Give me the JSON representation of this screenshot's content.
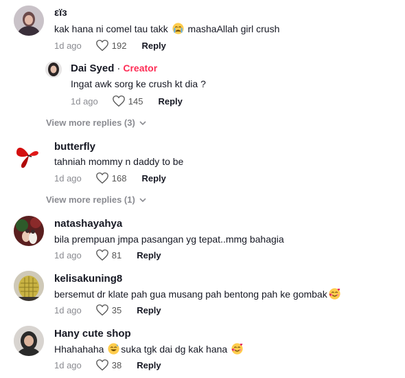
{
  "comments": [
    {
      "username": "εïз",
      "text_before": "kak hana ni comel tau takk ",
      "emoji": "crying-face-emoji",
      "text_after": " mashaAllah girl crush",
      "time": "1d ago",
      "likes": "192",
      "reply_label": "Reply"
    },
    {
      "username": "butterfly",
      "text": "tahniah mommy n daddy to be",
      "time": "1d ago",
      "likes": "168",
      "reply_label": "Reply"
    },
    {
      "username": "natashayahya",
      "text": "bila prempuan jmpa pasangan yg tepat..mmg bahagia",
      "time": "1d ago",
      "likes": "81",
      "reply_label": "Reply"
    },
    {
      "username": "kelisakuning8",
      "text": "bersemut dr klate pah gua musang pah bentong pah ke gombak",
      "emoji": "smiling-face-with-hearts-emoji",
      "time": "1d ago",
      "likes": "35",
      "reply_label": "Reply"
    },
    {
      "username": "Hany cute shop",
      "text_before": "Hhahahaha ",
      "emoji": "grinning-sweat-emoji",
      "text_after": "suka tgk dai dg kak hana ",
      "emoji2": "smiling-face-with-hearts-emoji",
      "time": "1d ago",
      "likes": "38",
      "reply_label": "Reply"
    }
  ],
  "creator_reply": {
    "username": "Dai Syed",
    "separator": "·",
    "badge": "Creator",
    "text": "Ingat awk sorg ke crush kt dia ?",
    "time": "1d ago",
    "likes": "145",
    "reply_label": "Reply"
  },
  "view_more": [
    {
      "label": "View more replies (3)"
    },
    {
      "label": "View more replies (1)"
    }
  ],
  "colors": {
    "creator_badge": "#fe2c55",
    "meta_text": "#8a8b91",
    "primary_text": "#161823"
  }
}
